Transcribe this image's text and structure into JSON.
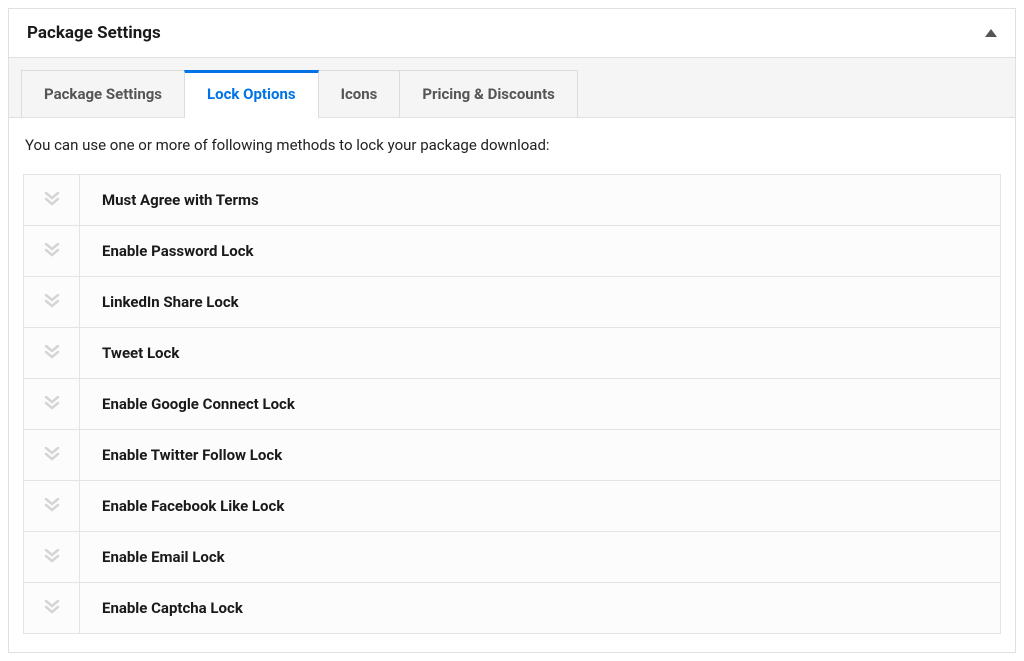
{
  "panel": {
    "title": "Package Settings"
  },
  "tabs": [
    {
      "label": "Package Settings",
      "active": false
    },
    {
      "label": "Lock Options",
      "active": true
    },
    {
      "label": "Icons",
      "active": false
    },
    {
      "label": "Pricing & Discounts",
      "active": false
    }
  ],
  "intro": "You can use one or more of following methods to lock your package download:",
  "lock_options": [
    {
      "label": "Must Agree with Terms"
    },
    {
      "label": "Enable Password Lock"
    },
    {
      "label": "LinkedIn Share Lock"
    },
    {
      "label": "Tweet Lock"
    },
    {
      "label": "Enable Google Connect Lock"
    },
    {
      "label": "Enable Twitter Follow Lock"
    },
    {
      "label": "Enable Facebook Like Lock"
    },
    {
      "label": "Enable Email Lock"
    },
    {
      "label": "Enable Captcha Lock"
    }
  ]
}
